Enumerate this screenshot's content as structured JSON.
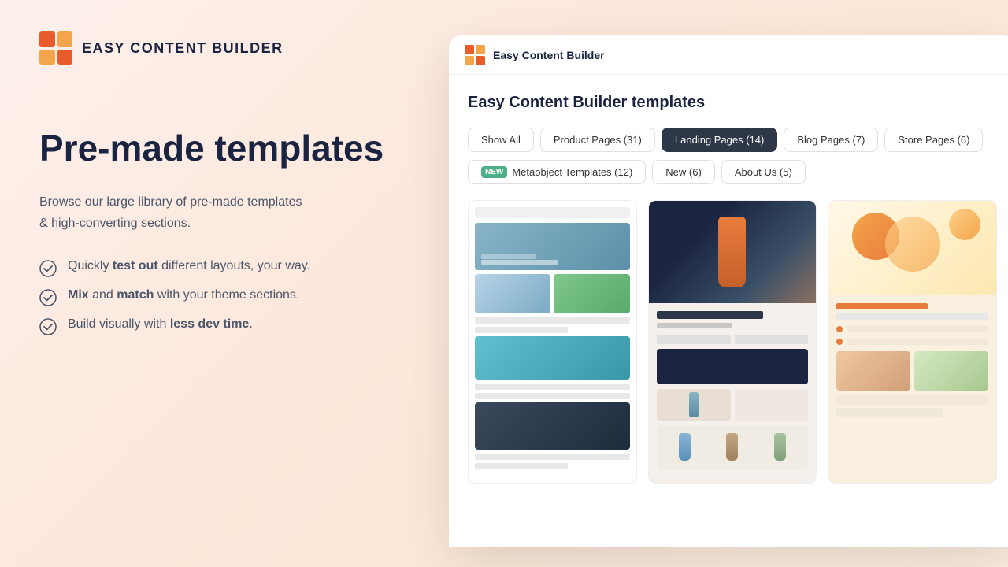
{
  "app": {
    "logo_text": "EASY CONTENT BUILDER",
    "app_title": "Easy Content Builder"
  },
  "left": {
    "heading": "Pre-made templates",
    "subtext_line1": "Browse our large library of pre-made templates",
    "subtext_line2": "& high-converting sections.",
    "feature1_normal": "Quickly ",
    "feature1_bold": "test out",
    "feature1_rest": " different layouts, your way.",
    "feature2_bold1": "Mix",
    "feature2_normal": " and ",
    "feature2_bold2": "match",
    "feature2_rest": " with your theme sections.",
    "feature3_normal": "Build visually with ",
    "feature3_bold": "less dev time",
    "feature3_rest": "."
  },
  "app_content": {
    "templates_heading": "Easy Content Builder templates",
    "filters_row1": [
      {
        "label": "Show All",
        "active": false
      },
      {
        "label": "Product Pages (31)",
        "active": false
      },
      {
        "label": "Landing Pages (14)",
        "active": true
      },
      {
        "label": "Blog Pages (7)",
        "active": false
      },
      {
        "label": "Store Pages (6)",
        "active": false
      }
    ],
    "filters_row2": [
      {
        "label": "Metaobject Templates (12)",
        "active": false,
        "new": true
      },
      {
        "label": "New (6)",
        "active": false
      },
      {
        "label": "About Us (5)",
        "active": false
      }
    ]
  }
}
